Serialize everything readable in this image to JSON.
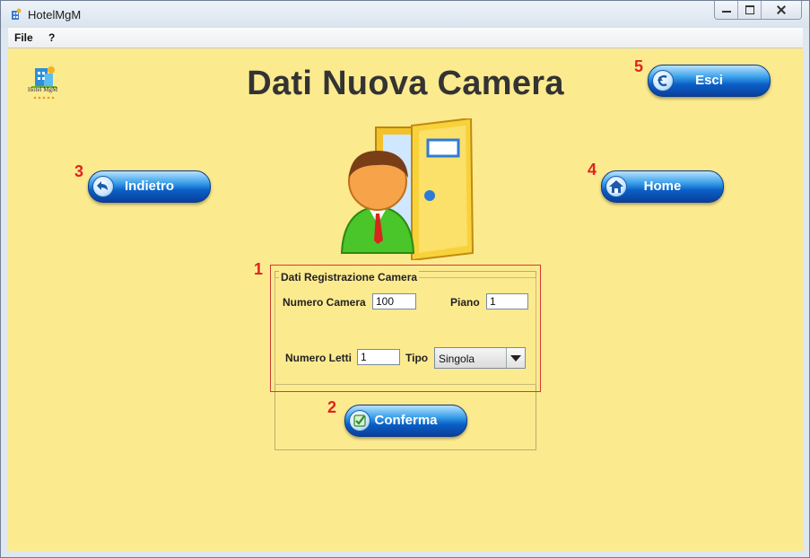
{
  "window": {
    "title": "HotelMgM"
  },
  "menu": {
    "items": [
      "File",
      "?"
    ]
  },
  "logo": {
    "text": "Hotel MgM"
  },
  "header": {
    "title": "Dati Nuova Camera"
  },
  "buttons": {
    "exit": "Esci",
    "back": "Indietro",
    "home": "Home",
    "confirm": "Conferma"
  },
  "annotations": {
    "a1": "1",
    "a2": "2",
    "a3": "3",
    "a4": "4",
    "a5": "5"
  },
  "form": {
    "group_title": "Dati Registrazione Camera",
    "room_number_label": "Numero Camera",
    "room_number_value": "100",
    "floor_label": "Piano",
    "floor_value": "1",
    "beds_label": "Numero Letti",
    "beds_value": "1",
    "type_label": "Tipo",
    "type_value": "Singola"
  },
  "colors": {
    "background": "#fcea8f",
    "button_blue": "#0a5fc6",
    "annotation_red": "#e0231d"
  }
}
